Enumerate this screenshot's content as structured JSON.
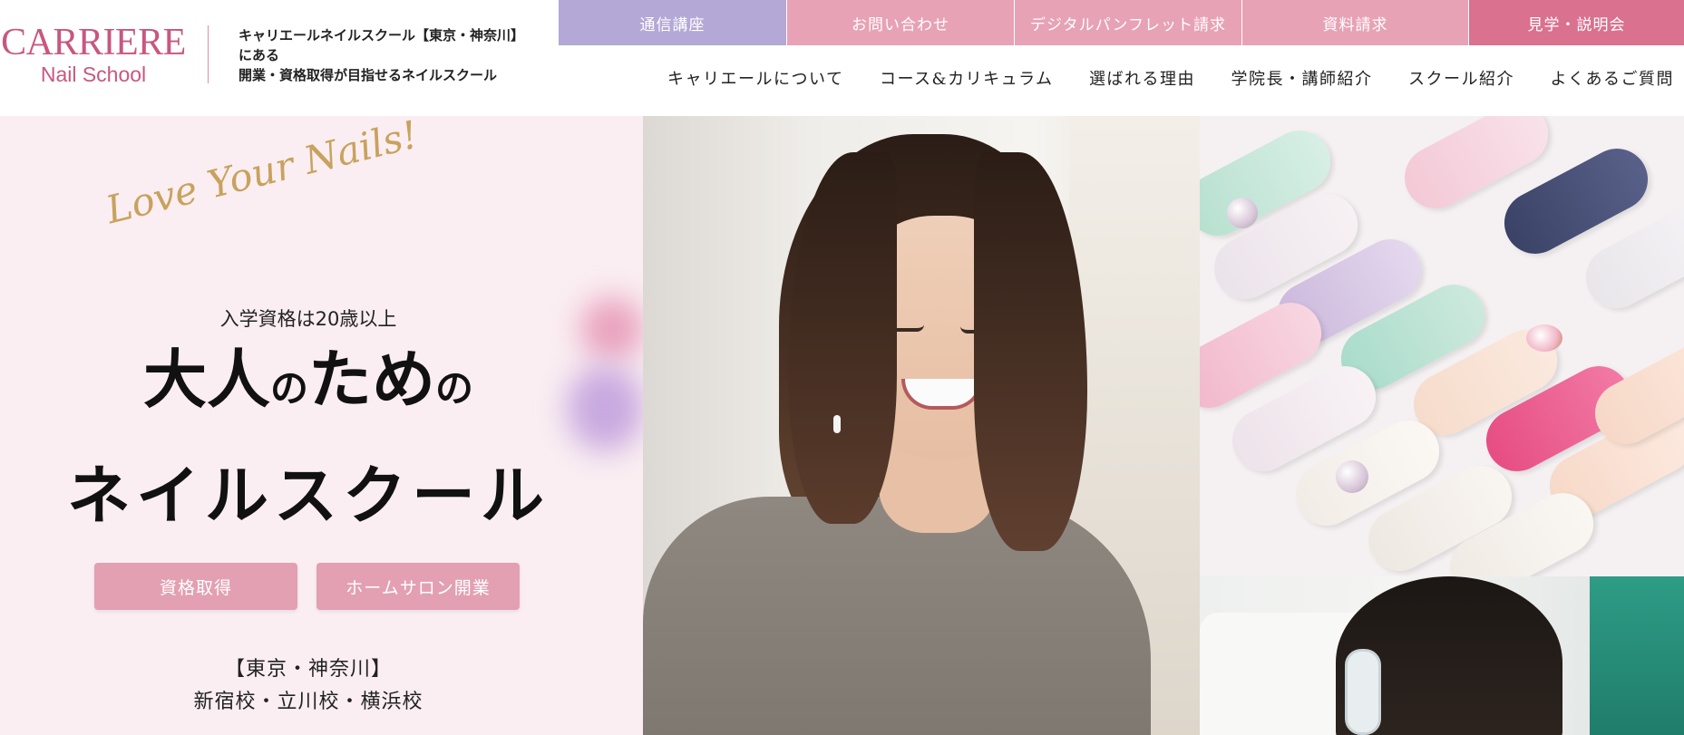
{
  "header": {
    "logo": {
      "main": "CARRIERE",
      "sub": "Nail School"
    },
    "tagline": [
      "キャリエールネイルスクール【東京・神奈川】",
      "にある",
      "開業・資格取得が目指せるネイルスクール"
    ],
    "top_buttons": [
      {
        "label": "通信講座",
        "color": "#b3a8d6"
      },
      {
        "label": "お問い合わせ",
        "color": "#e7a2b5"
      },
      {
        "label": "デジタルパンフレット請求",
        "color": "#e7a2b5"
      },
      {
        "label": "資料請求",
        "color": "#e7a2b5"
      },
      {
        "label": "見学・説明会",
        "color": "#d9718f"
      }
    ],
    "nav": [
      "キャリエールについて",
      "コース&カリキュラム",
      "選ばれる理由",
      "学院長・講師紹介",
      "スクール紹介",
      "よくあるご質問"
    ]
  },
  "hero": {
    "script": "Love Your Nails!",
    "admission": "入学資格は20歳以上",
    "headline_line1": [
      "大人",
      "の",
      "ため",
      "の"
    ],
    "headline_line2": "ネイルスクール",
    "buttons": {
      "certification": "資格取得",
      "home_salon": "ホームサロン開業"
    },
    "area": "【東京・神奈川】",
    "campuses": "新宿校・立川校・横浜校"
  },
  "colors": {
    "brand": "#c8577f",
    "hero_bg": "#faeef2",
    "hero_button": "#e3a0b2",
    "script_gold": "#c8a25e",
    "lavender": "#b3a8d6"
  }
}
